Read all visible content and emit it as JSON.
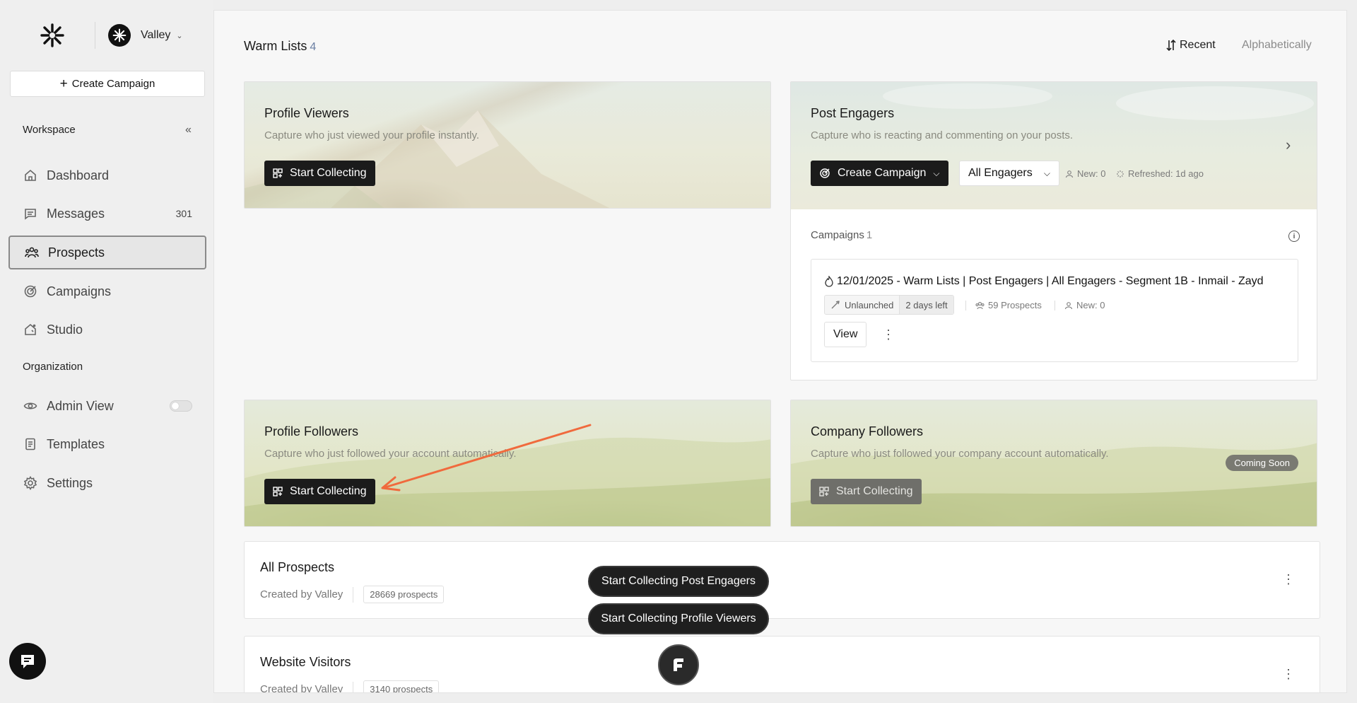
{
  "workspace": {
    "name": "Valley"
  },
  "sidebar": {
    "create_label": "Create Campaign",
    "workspace_label": "Workspace",
    "organization_label": "Organization",
    "items": [
      {
        "label": "Dashboard",
        "icon": "home-icon"
      },
      {
        "label": "Messages",
        "icon": "message-icon",
        "count": "301"
      },
      {
        "label": "Prospects",
        "icon": "users-icon",
        "active": true
      },
      {
        "label": "Campaigns",
        "icon": "target-icon"
      },
      {
        "label": "Studio",
        "icon": "studio-icon"
      }
    ],
    "org_items": [
      {
        "label": "Admin View",
        "icon": "eye-icon"
      },
      {
        "label": "Templates",
        "icon": "document-icon"
      },
      {
        "label": "Settings",
        "icon": "gear-icon"
      }
    ]
  },
  "main": {
    "title": "Warm Lists",
    "title_count": "4",
    "sort": {
      "recent": "Recent",
      "alpha": "Alphabetically"
    }
  },
  "cards": {
    "profile_viewers": {
      "title": "Profile Viewers",
      "subtitle": "Capture who just viewed your profile instantly.",
      "button": "Start Collecting"
    },
    "post_engagers": {
      "title": "Post Engagers",
      "subtitle": "Capture who is reacting and commenting on your posts.",
      "create_button": "Create Campaign",
      "filter_value": "All Engagers",
      "new_text": "New: 0",
      "refreshed_text": "Refreshed: 1d ago",
      "campaigns_label": "Campaigns",
      "campaigns_count": "1",
      "campaign": {
        "name": "12/01/2025 - Warm Lists | Post Engagers | All Engagers - Segment 1B - Inmail - Zayd",
        "status": "Unlaunched",
        "days_left": "2 days left",
        "prospects": "59 Prospects",
        "new_text": "New: 0",
        "view_label": "View"
      }
    },
    "profile_followers": {
      "title": "Profile Followers",
      "subtitle": "Capture who just followed your account automatically.",
      "button": "Start Collecting"
    },
    "company_followers": {
      "title": "Company Followers",
      "subtitle": "Capture who just followed your company account automatically.",
      "button": "Start Collecting",
      "badge": "Coming Soon"
    }
  },
  "lists": [
    {
      "title": "All Prospects",
      "created_by": "Created by Valley",
      "count": "28669 prospects"
    },
    {
      "title": "Website Visitors",
      "created_by": "Created by Valley",
      "count": "3140 prospects"
    }
  ],
  "floating": {
    "post_engagers": "Start Collecting Post Engagers",
    "profile_viewers": "Start Collecting Profile Viewers"
  },
  "colors": {
    "accent_arrow": "#f06a3d",
    "dark": "#1b1b1b"
  }
}
